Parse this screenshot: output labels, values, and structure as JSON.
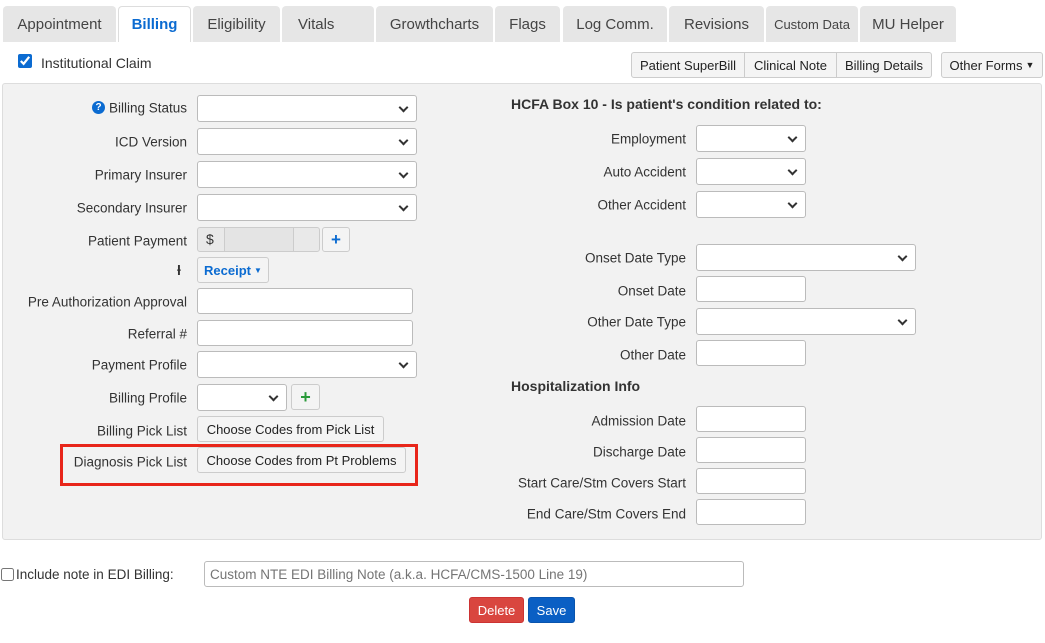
{
  "tabs": [
    "Appointment",
    "Billing",
    "Eligibility",
    "Vitals",
    "Growthcharts",
    "Flags",
    "Log Comm.",
    "Revisions",
    "Custom Data",
    "MU Helper"
  ],
  "institutional_claim": {
    "label": "Institutional Claim",
    "checked": true
  },
  "top_buttons": {
    "superbill": "Patient SuperBill",
    "clinical_note": "Clinical Note",
    "billing_details": "Billing Details",
    "other_forms": "Other Forms"
  },
  "left": {
    "billing_status": "Billing Status",
    "icd_version": "ICD Version",
    "primary_insurer": "Primary Insurer",
    "secondary_insurer": "Secondary Insurer",
    "patient_payment": "Patient Payment",
    "currency": "$",
    "plus": "+",
    "receipt_label": "Receipt",
    "pre_auth": "Pre Authorization Approval",
    "referral": "Referral #",
    "payment_profile": "Payment Profile",
    "billing_profile": "Billing Profile",
    "billing_pick_list": "Billing Pick List",
    "billing_pick_btn": "Choose Codes from Pick List",
    "diagnosis_pick_list": "Diagnosis Pick List",
    "diagnosis_pick_btn": "Choose Codes from Pt Problems"
  },
  "right": {
    "hcfa_header": "HCFA Box 10 - Is patient's condition related to:",
    "employment": "Employment",
    "auto_accident": "Auto Accident",
    "other_accident": "Other Accident",
    "onset_date_type": "Onset Date Type",
    "onset_date": "Onset Date",
    "other_date_type": "Other Date Type",
    "other_date": "Other Date",
    "hospitalization_header": "Hospitalization Info",
    "admission_date": "Admission Date",
    "discharge_date": "Discharge Date",
    "start_care": "Start Care/Stm Covers Start",
    "end_care": "End Care/Stm Covers End"
  },
  "edi": {
    "label": "Include note in EDI Billing:",
    "placeholder": "Custom NTE EDI Billing Note (a.k.a. HCFA/CMS-1500 Line 19)",
    "checked": false
  },
  "actions": {
    "delete": "Delete",
    "save": "Save"
  },
  "colors": {
    "accent": "#0b6bd1",
    "delete": "#d9463f",
    "save": "#0a5fc4",
    "highlight": "#e8261a"
  }
}
